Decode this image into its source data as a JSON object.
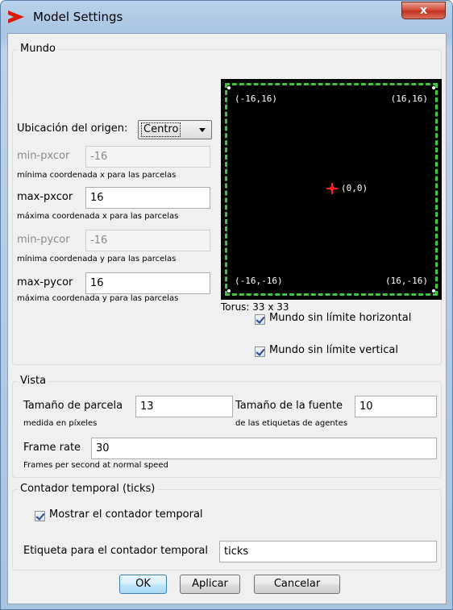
{
  "window": {
    "title": "Model Settings",
    "close_label": "x"
  },
  "mundo": {
    "title": "Mundo",
    "origin_label": "Ubicación del origen:",
    "origin_value": "Centro",
    "min_pxcor": {
      "label": "min-pxcor",
      "value": "-16",
      "hint": "mínima coordenada x para las parcelas"
    },
    "max_pxcor": {
      "label": "max-pxcor",
      "value": "16",
      "hint": "máxima coordenada x para las parcelas"
    },
    "min_pycor": {
      "label": "min-pycor",
      "value": "-16",
      "hint": "mínima coordenada y para las parcelas"
    },
    "max_pycor": {
      "label": "max-pycor",
      "value": "16",
      "hint": "máxima coordenada y para las parcelas"
    },
    "preview": {
      "tl": "(-16,16)",
      "tr": "(16,16)",
      "bl": "(-16,-16)",
      "br": "(16,-16)",
      "center": "(0,0)"
    },
    "torus": "Torus: 33 x 33",
    "wrap_h_label": "Mundo sin límite horizontal",
    "wrap_v_label": "Mundo sin límite vertical",
    "wrap_h_checked": true,
    "wrap_v_checked": true
  },
  "vista": {
    "title": "Vista",
    "patch_size_label": "Tamaño de parcela",
    "patch_size_value": "13",
    "patch_size_hint": "medida en píxeles",
    "font_size_label": "Tamaño de la fuente",
    "font_size_value": "10",
    "font_size_hint": "de las etiquetas de agentes",
    "frame_rate_label": "Frame rate",
    "frame_rate_value": "30",
    "frame_rate_hint": "Frames per second at normal speed"
  },
  "ticks": {
    "title": "Contador temporal (ticks)",
    "show_label": "Mostrar el contador temporal",
    "show_checked": true,
    "label_label": "Etiqueta para el contador temporal",
    "label_value": "ticks"
  },
  "buttons": {
    "ok": "OK",
    "apply": "Aplicar",
    "cancel": "Cancelar"
  },
  "colors": {
    "world_bg": "#000000",
    "world_border": "#3ec63e",
    "origin_marker": "#ff2020",
    "title_icon": "#d81c0c"
  }
}
